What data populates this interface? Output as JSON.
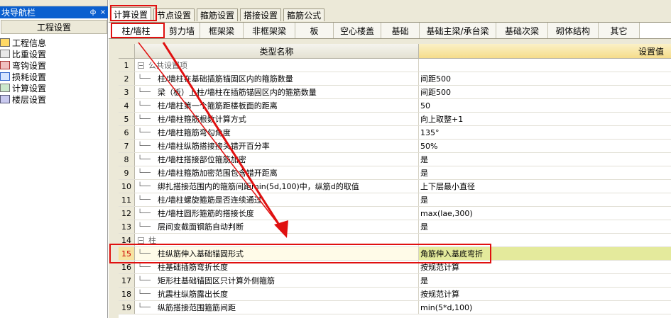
{
  "nav": {
    "title": "模块导航栏",
    "title_visible": "块导航栏",
    "pin": "ф",
    "close": "×",
    "section": "工程设置",
    "items": [
      {
        "label": "工程信息",
        "icon": "magnifier-doc-icon"
      },
      {
        "label": "比重设置",
        "icon": "ruler-icon"
      },
      {
        "label": "弯钩设置",
        "icon": "hook-icon"
      },
      {
        "label": "损耗设置",
        "icon": "loss-icon"
      },
      {
        "label": "计算设置",
        "icon": "calc-icon"
      },
      {
        "label": "楼层设置",
        "icon": "floors-icon"
      }
    ]
  },
  "top_tabs": [
    "计算设置",
    "节点设置",
    "箍筋设置",
    "搭接设置",
    "箍筋公式"
  ],
  "sub_tabs": [
    "柱/墙柱",
    "剪力墙",
    "框架梁",
    "非框架梁",
    "板",
    "空心楼盖",
    "基础",
    "基础主梁/承台梁",
    "基础次梁",
    "砌体结构",
    "其它"
  ],
  "grid": {
    "header_name": "类型名称",
    "header_value": "设置值",
    "rows": [
      {
        "num": "1",
        "name": "公共设置项",
        "value": "",
        "section": true
      },
      {
        "num": "2",
        "name": "柱/墙柱在基础插筋锚固区内的箍筋数量",
        "value": "间距500"
      },
      {
        "num": "3",
        "name": "梁（板）上柱/墙柱在插筋锚固区内的箍筋数量",
        "value": "间距500"
      },
      {
        "num": "4",
        "name": "柱/墙柱第一个箍筋距楼板面的距离",
        "value": "50"
      },
      {
        "num": "5",
        "name": "柱/墙柱箍筋根数计算方式",
        "value": "向上取整+1"
      },
      {
        "num": "6",
        "name": "柱/墙柱箍筋弯勾角度",
        "value": "135°"
      },
      {
        "num": "7",
        "name": "柱/墙柱纵筋搭接接头错开百分率",
        "value": "50%"
      },
      {
        "num": "8",
        "name": "柱/墙柱搭接部位箍筋加密",
        "value": "是"
      },
      {
        "num": "9",
        "name": "柱/墙柱箍筋加密范围包含错开距离",
        "value": "是"
      },
      {
        "num": "10",
        "name": "绑扎搭接范围内的箍筋间距min(5d,100)中，纵筋d的取值",
        "value": "上下层最小直径"
      },
      {
        "num": "11",
        "name": "柱/墙柱螺旋箍筋是否连续通过",
        "value": "是"
      },
      {
        "num": "12",
        "name": "柱/墙柱圆形箍筋的搭接长度",
        "value": "max(lae,300)"
      },
      {
        "num": "13",
        "name": "层间变截面钢筋自动判断",
        "value": "是"
      },
      {
        "num": "14",
        "name": "柱",
        "value": "",
        "section": true
      },
      {
        "num": "15",
        "name": "柱纵筋伸入基础锚固形式",
        "value": "角筋伸入基底弯折",
        "selected": true
      },
      {
        "num": "16",
        "name": "柱基础插筋弯折长度",
        "value": "按规范计算"
      },
      {
        "num": "17",
        "name": "矩形柱基础锚固区只计算外侧箍筋",
        "value": "是"
      },
      {
        "num": "18",
        "name": "抗震柱纵筋露出长度",
        "value": "按规范计算"
      },
      {
        "num": "19",
        "name": "纵筋搭接范围箍筋间距",
        "value": "min(5*d,100)"
      }
    ]
  },
  "colors": {
    "accent_red": "#e01010",
    "nav_title": "#0a5fcf",
    "value_header": "#f5dc8a"
  }
}
